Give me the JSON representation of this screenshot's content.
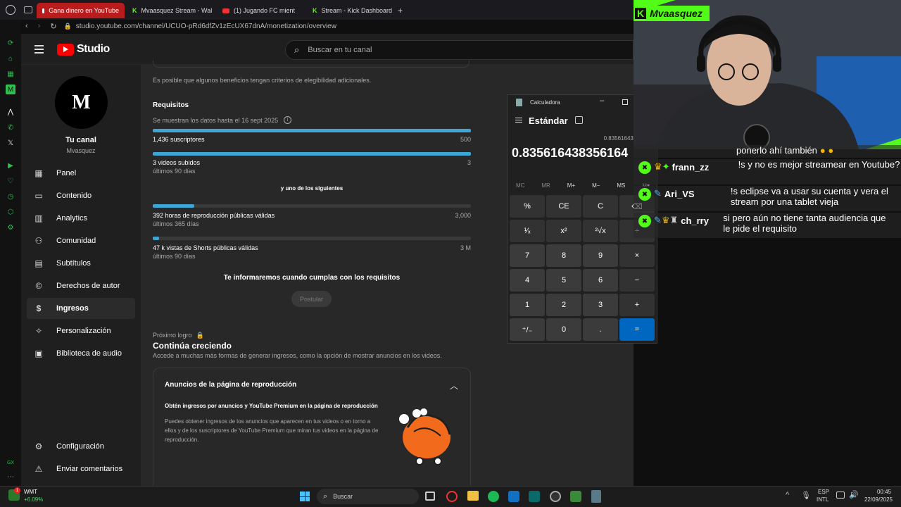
{
  "browser": {
    "tabs": [
      {
        "label": "Gana dinero en YouTube",
        "active": true
      },
      {
        "label": "Mvaasquez Stream - Wal",
        "active": false
      },
      {
        "label": "(1) Jugando FC mient",
        "active": false
      },
      {
        "label": "Stream - Kick Dashboard",
        "active": false
      }
    ],
    "url": "studio.youtube.com/channel/UCUO-pRd6dfZv1zEcUX67dnA/monetization/overview"
  },
  "header": {
    "logo": "Studio",
    "search_placeholder": "Buscar en tu canal"
  },
  "channel": {
    "avatar_letters": "M",
    "title": "Tu canal",
    "name": "Mvasquez"
  },
  "sidebar": {
    "items": [
      {
        "label": "Panel",
        "icon": "dashboard-icon"
      },
      {
        "label": "Contenido",
        "icon": "content-icon"
      },
      {
        "label": "Analytics",
        "icon": "analytics-icon"
      },
      {
        "label": "Comunidad",
        "icon": "community-icon"
      },
      {
        "label": "Subtítulos",
        "icon": "subtitles-icon"
      },
      {
        "label": "Derechos de autor",
        "icon": "copyright-icon"
      },
      {
        "label": "Ingresos",
        "icon": "dollar-icon"
      },
      {
        "label": "Personalización",
        "icon": "wand-icon"
      },
      {
        "label": "Biblioteca de audio",
        "icon": "audio-library-icon"
      }
    ],
    "bottom": [
      {
        "label": "Configuración",
        "icon": "settings-icon"
      },
      {
        "label": "Enviar comentarios",
        "icon": "feedback-icon"
      }
    ]
  },
  "main": {
    "eligibility_note": "Es posible que algunos beneficios tengan criterios de elegibilidad adicionales.",
    "requirements_title": "Requisitos",
    "data_note": "Se muestran los datos hasta el 16 sept 2025",
    "requirements": [
      {
        "label": "1,436 suscriptores",
        "sub": "",
        "target": "500",
        "progress": 1.0
      },
      {
        "label": "3 videos subidos",
        "sub": "últimos 90 días",
        "target": "3",
        "progress": 1.0
      }
    ],
    "or_label": "y uno de los siguientes",
    "alt_requirements": [
      {
        "label": "392 horas de reproducción públicas válidas",
        "sub": "últimos 365 días",
        "target": "3,000",
        "progress": 0.13
      },
      {
        "label": "47 k vistas de Shorts públicas válidas",
        "sub": "últimos 90 días",
        "target": "3 M",
        "progress": 0.02
      }
    ],
    "notify": "Te informaremos cuando cumplas con los requisitos",
    "apply_button": "Postular",
    "next_label": "Próximo logro",
    "next_title": "Continúa creciendo",
    "next_desc": "Accede a muchas más formas de generar ingresos, como la opción de mostrar anuncios en los videos.",
    "card_title": "Anuncios de la página de reproducción",
    "card_heading": "Obtén ingresos por anuncios y YouTube Premium en la página de reproducción",
    "card_body": "Puedes obtener ingresos de los anuncios que aparecen en tus videos o en torno a ellos y de los suscriptores de YouTube Premium que miran tus videos en la página de reproducción."
  },
  "calculator": {
    "title": "Calculadora",
    "mode": "Estándar",
    "expression": "0.835616438356164",
    "display": "0.835616438356164",
    "memory": [
      "MC",
      "MR",
      "M+",
      "M−",
      "MS",
      "M▾"
    ],
    "keys": [
      "%",
      "CE",
      "C",
      "⌫",
      "¹⁄ₓ",
      "x²",
      "²√x",
      "÷",
      "7",
      "8",
      "9",
      "×",
      "4",
      "5",
      "6",
      "−",
      "1",
      "2",
      "3",
      "+",
      "⁺/₋",
      "0",
      ".",
      "="
    ]
  },
  "stream": {
    "streamer": "Mvaasquez",
    "chat": [
      {
        "user": "",
        "message": "ponerlo ahí también"
      },
      {
        "user": "frann_zz",
        "message": "!s y no es mejor streamear en Youtube?"
      },
      {
        "user": "Ari_VS",
        "message": "!s eclipse va a usar su cuenta y vera el stream por una tablet vieja"
      },
      {
        "user": "ch_rry",
        "message": "si pero aún no tiene tanta audiencia que le pide el requisito"
      }
    ]
  },
  "taskbar": {
    "stock_name": "WMT",
    "stock_change": "+6.09%",
    "search": "Buscar",
    "lang": "ESP",
    "layout": "INTL",
    "time": "00:45",
    "date": "22/09/2025"
  }
}
